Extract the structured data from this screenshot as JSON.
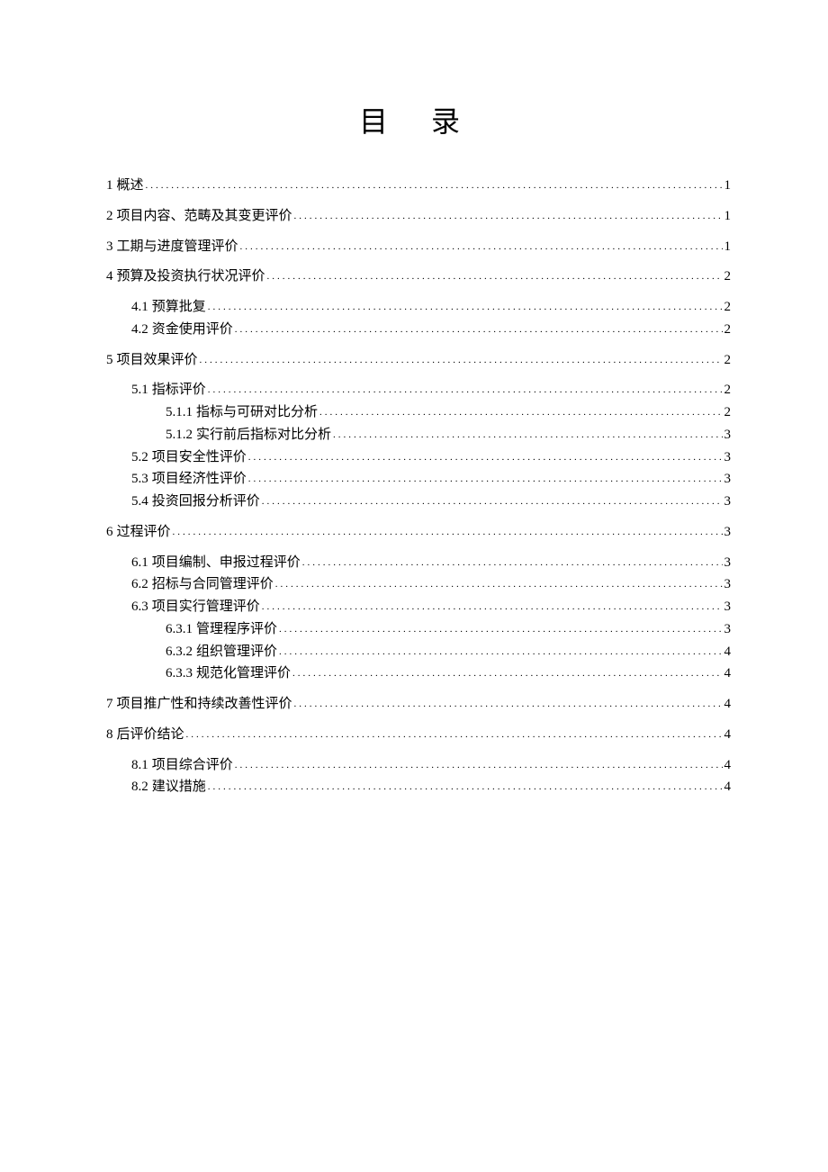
{
  "title": "目 录",
  "toc": [
    {
      "level": 1,
      "num": "1",
      "text": "概述",
      "page": "1"
    },
    {
      "level": 1,
      "num": "2",
      "text": "项目内容、范畴及其变更评价",
      "page": "1"
    },
    {
      "level": 1,
      "num": "3",
      "text": "工期与进度管理评价",
      "page": "1"
    },
    {
      "level": 1,
      "num": "4",
      "text": "预算及投资执行状况评价",
      "page": "2"
    },
    {
      "level": 2,
      "num": "4.1",
      "text": "预算批复",
      "page": "2"
    },
    {
      "level": 2,
      "num": "4.2",
      "text": "资金使用评价",
      "page": "2"
    },
    {
      "level": 1,
      "num": "5",
      "text": "项目效果评价",
      "page": "2"
    },
    {
      "level": 2,
      "num": "5.1",
      "text": "指标评价",
      "page": "2"
    },
    {
      "level": 3,
      "num": "5.1.1",
      "text": "指标与可研对比分析",
      "page": "2"
    },
    {
      "level": 3,
      "num": "5.1.2",
      "text": "实行前后指标对比分析",
      "page": "3"
    },
    {
      "level": 2,
      "num": "5.2",
      "text": "项目安全性评价",
      "page": "3"
    },
    {
      "level": 2,
      "num": "5.3",
      "text": "项目经济性评价",
      "page": "3"
    },
    {
      "level": 2,
      "num": "5.4",
      "text": "投资回报分析评价",
      "page": "3"
    },
    {
      "level": 1,
      "num": "6",
      "text": "过程评价",
      "page": "3"
    },
    {
      "level": 2,
      "num": "6.1",
      "text": "项目编制、申报过程评价",
      "page": "3"
    },
    {
      "level": 2,
      "num": "6.2",
      "text": "招标与合同管理评价",
      "page": "3"
    },
    {
      "level": 2,
      "num": "6.3",
      "text": "项目实行管理评价",
      "page": "3"
    },
    {
      "level": 3,
      "num": "6.3.1",
      "text": "管理程序评价",
      "page": "3"
    },
    {
      "level": 3,
      "num": "6.3.2",
      "text": "组织管理评价",
      "page": "4"
    },
    {
      "level": 3,
      "num": "6.3.3",
      "text": "规范化管理评价",
      "page": "4"
    },
    {
      "level": 1,
      "num": "7",
      "text": "项目推广性和持续改善性评价",
      "page": "4"
    },
    {
      "level": 1,
      "num": "8",
      "text": "后评价结论",
      "page": "4"
    },
    {
      "level": 2,
      "num": "8.1",
      "text": "项目综合评价",
      "page": "4"
    },
    {
      "level": 2,
      "num": "8.2",
      "text": "建议措施",
      "page": "4"
    }
  ]
}
